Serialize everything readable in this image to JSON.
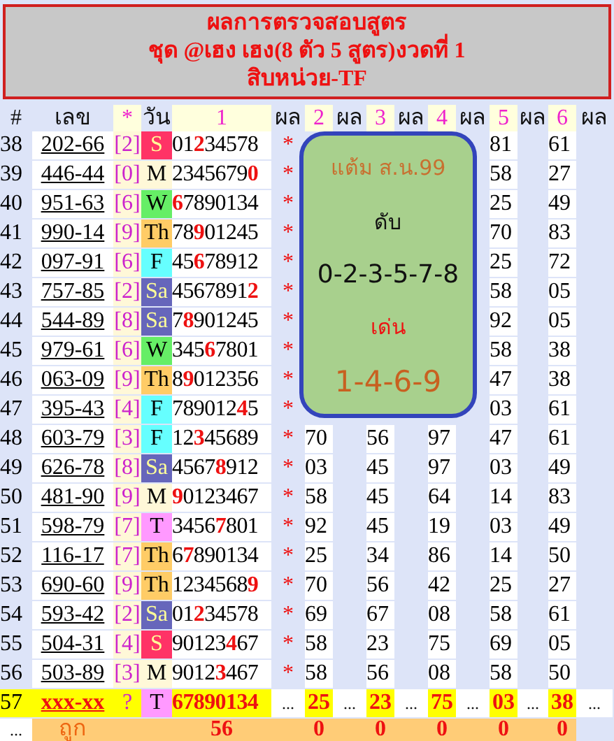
{
  "banner": {
    "lines": [
      "ผลการตรวจสอบสูตร",
      "ชุด @เฮง เฮง(8 ตัว 5 สูตร)งวดที่ 1",
      "สิบหน่วย-TF"
    ]
  },
  "columns": [
    "#",
    "เลข",
    "*",
    "วัน",
    "1",
    "ผล",
    "2",
    "ผล",
    "3",
    "ผล",
    "4",
    "ผล",
    "5",
    "ผล",
    "6",
    "ผล"
  ],
  "rows": [
    {
      "no": "38",
      "number": "202-66",
      "bracket": "[2]",
      "day": {
        "label": "S",
        "color": "#ff3366"
      },
      "digits": "01**2**34578",
      "mark": "*",
      "values": [
        "81",
        "61"
      ]
    },
    {
      "no": "39",
      "number": "446-44",
      "bracket": "[0]",
      "day": {
        "label": "M",
        "color": "#fff8d8"
      },
      "digits": "2345679**0**",
      "mark": "*",
      "values": [
        "58",
        "27"
      ]
    },
    {
      "no": "40",
      "number": "951-63",
      "bracket": "[6]",
      "day": {
        "label": "W",
        "color": "#66ee66"
      },
      "digits": "**6**7890134",
      "mark": "*",
      "values": [
        "25",
        "49"
      ]
    },
    {
      "no": "41",
      "number": "990-14",
      "bracket": "[9]",
      "day": {
        "label": "Th",
        "color": "#ffcc66"
      },
      "digits": "78**9**01245",
      "mark": "*",
      "values": [
        "70",
        "83"
      ]
    },
    {
      "no": "42",
      "number": "097-91",
      "bracket": "[6]",
      "day": {
        "label": "F",
        "color": "#66ffff"
      },
      "digits": "45**6**78912",
      "mark": "*",
      "values": [
        "25",
        "72"
      ]
    },
    {
      "no": "43",
      "number": "757-85",
      "bracket": "[2]",
      "day": {
        "label": "Sa",
        "color": "#6666bb"
      },
      "digits": "4567891**2**",
      "mark": "*",
      "values": [
        "58",
        "05"
      ]
    },
    {
      "no": "44",
      "number": "544-89",
      "bracket": "[8]",
      "day": {
        "label": "Sa",
        "color": "#6666bb"
      },
      "digits": "7**8**901245",
      "mark": "*",
      "values": [
        "92",
        "05"
      ]
    },
    {
      "no": "45",
      "number": "979-61",
      "bracket": "[6]",
      "day": {
        "label": "W",
        "color": "#66ee66"
      },
      "digits": "345**6**7801",
      "mark": "*",
      "values": [
        "58",
        "38"
      ]
    },
    {
      "no": "46",
      "number": "063-09",
      "bracket": "[9]",
      "day": {
        "label": "Th",
        "color": "#ffcc66"
      },
      "digits": "8**9**012356",
      "mark": "*",
      "values": [
        "47",
        "38"
      ]
    },
    {
      "no": "47",
      "number": "395-43",
      "bracket": "[4]",
      "day": {
        "label": "F",
        "color": "#66ffff"
      },
      "digits": "789012**4**5",
      "mark": "*",
      "values": [
        "03",
        "61"
      ]
    },
    {
      "no": "48",
      "number": "603-79",
      "bracket": "[3]",
      "day": {
        "label": "F",
        "color": "#66ffff"
      },
      "digits": "12**3**45689",
      "mark": "*",
      "values": [
        "70",
        "56",
        "97",
        "47",
        "61"
      ]
    },
    {
      "no": "49",
      "number": "626-78",
      "bracket": "[8]",
      "day": {
        "label": "Sa",
        "color": "#6666bb"
      },
      "digits": "4567**8**912",
      "mark": "*",
      "values": [
        "03",
        "45",
        "97",
        "03",
        "49"
      ]
    },
    {
      "no": "50",
      "number": "481-90",
      "bracket": "[9]",
      "day": {
        "label": "M",
        "color": "#fff8d8"
      },
      "digits": "**9**0123467",
      "mark": "*",
      "values": [
        "58",
        "45",
        "64",
        "14",
        "83"
      ]
    },
    {
      "no": "51",
      "number": "598-79",
      "bracket": "[7]",
      "day": {
        "label": "T",
        "color": "#ff99ff"
      },
      "digits": "3456**7**801",
      "mark": "*",
      "values": [
        "92",
        "45",
        "19",
        "03",
        "49"
      ]
    },
    {
      "no": "52",
      "number": "116-17",
      "bracket": "[7]",
      "day": {
        "label": "Th",
        "color": "#ffcc66"
      },
      "digits": "6**7**890134",
      "mark": "*",
      "values": [
        "25",
        "34",
        "86",
        "14",
        "50"
      ]
    },
    {
      "no": "53",
      "number": "690-60",
      "bracket": "[9]",
      "day": {
        "label": "Th",
        "color": "#ffcc66"
      },
      "digits": "1234568**9**",
      "mark": "*",
      "values": [
        "70",
        "56",
        "42",
        "25",
        "27"
      ]
    },
    {
      "no": "54",
      "number": "593-42",
      "bracket": "[2]",
      "day": {
        "label": "Sa",
        "color": "#6666bb"
      },
      "digits": "01**2**34578",
      "mark": "*",
      "values": [
        "69",
        "67",
        "08",
        "58",
        "61"
      ]
    },
    {
      "no": "55",
      "number": "504-31",
      "bracket": "[4]",
      "day": {
        "label": "S",
        "color": "#ff3366"
      },
      "digits": "90123**4**67",
      "mark": "*",
      "values": [
        "58",
        "23",
        "75",
        "69",
        "05"
      ]
    },
    {
      "no": "56",
      "number": "503-89",
      "bracket": "[3]",
      "day": {
        "label": "M",
        "color": "#fff8d8"
      },
      "digits": "9012**3**467",
      "mark": "*",
      "values": [
        "58",
        "56",
        "08",
        "58",
        "50"
      ]
    }
  ],
  "pending": {
    "no": "57",
    "number": "xxx-xx",
    "bracket": "?",
    "day": {
      "label": "T",
      "color": "#ff99ff"
    },
    "digits": "67890134",
    "marks": [
      "...",
      "...",
      "...",
      "...",
      "...",
      "..."
    ],
    "values": [
      "25",
      "23",
      "75",
      "03",
      "38"
    ]
  },
  "totals": {
    "no": "...",
    "label": "ถูก",
    "values": [
      "56",
      "0",
      "0",
      "0",
      "0",
      "0"
    ]
  },
  "summary": {
    "title": "แต้ม ส.น.99",
    "drop_label": "ดับ",
    "drop": "0-2-3-5-7-8",
    "hot_label": "เด่น",
    "hot": "1-4-6-9"
  }
}
